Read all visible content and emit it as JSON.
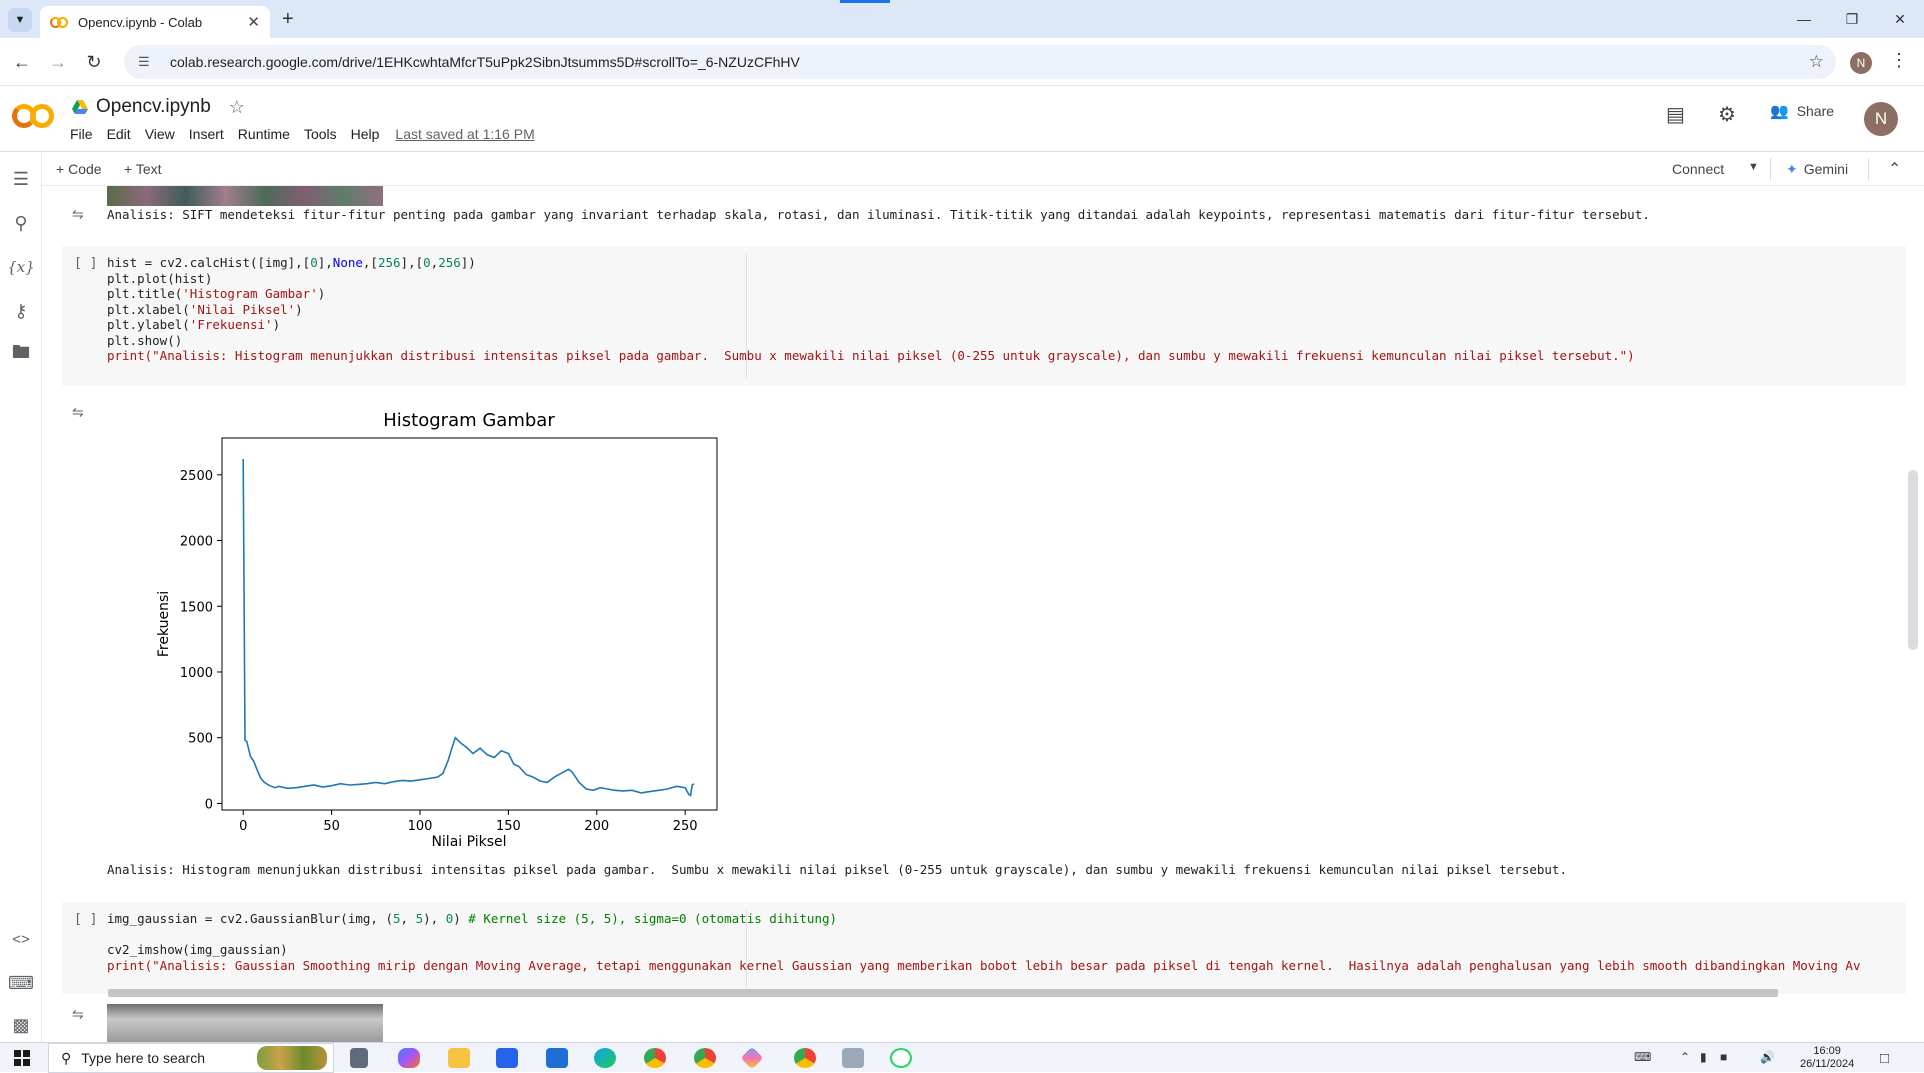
{
  "browser": {
    "tab_title": "Opencv.ipynb - Colab",
    "url": "colab.research.google.com/drive/1EHKcwhtaMfcrT5uPpk2SibnJtsumms5D#scrollTo=_6-NZUzCFhHV",
    "profile_initial": "N"
  },
  "colab": {
    "notebook_name": "Opencv.ipynb",
    "menu": [
      "File",
      "Edit",
      "View",
      "Insert",
      "Runtime",
      "Tools",
      "Help"
    ],
    "last_saved": "Last saved at 1:16 PM",
    "share_label": "Share",
    "user_initial": "N"
  },
  "toolbar": {
    "add_code": "Code",
    "add_text": "Text",
    "connect": "Connect",
    "gemini": "Gemini"
  },
  "cells": {
    "sift_output": "Analisis: SIFT mendeteksi fitur-fitur penting pada gambar yang invariant terhadap skala, rotasi, dan iluminasi. Titik-titik yang ditandai adalah keypoints, representasi matematis dari fitur-fitur tersebut.",
    "hist_run": "[ ]",
    "hist_output": "Analisis: Histogram menunjukkan distribusi intensitas piksel pada gambar.  Sumbu x mewakili nilai piksel (0-255 untuk grayscale), dan sumbu y mewakili frekuensi kemunculan nilai piksel tersebut.",
    "gauss_run": "[ ]"
  },
  "chart_data": {
    "type": "line",
    "title": "Histogram Gambar",
    "xlabel": "Nilai Piksel",
    "ylabel": "Frekuensi",
    "xlim": [
      -12,
      268
    ],
    "ylim": [
      -50,
      2780
    ],
    "xticks": [
      0,
      50,
      100,
      150,
      200,
      250
    ],
    "yticks": [
      0,
      500,
      1000,
      1500,
      2000,
      2500
    ],
    "color": "#1f77b4",
    "x": [
      0,
      1,
      2,
      4,
      6,
      8,
      10,
      12,
      15,
      18,
      20,
      25,
      30,
      35,
      40,
      45,
      50,
      55,
      60,
      65,
      70,
      75,
      80,
      85,
      90,
      95,
      100,
      105,
      110,
      113,
      116,
      118,
      120,
      123,
      126,
      130,
      134,
      138,
      142,
      146,
      150,
      153,
      156,
      160,
      164,
      168,
      172,
      176,
      180,
      184,
      186,
      188,
      190,
      194,
      198,
      202,
      206,
      210,
      215,
      220,
      225,
      230,
      235,
      240,
      245,
      250,
      252,
      253,
      254,
      255
    ],
    "values": [
      2620,
      480,
      470,
      360,
      320,
      250,
      190,
      160,
      135,
      120,
      130,
      115,
      120,
      130,
      140,
      125,
      135,
      150,
      140,
      145,
      150,
      160,
      150,
      165,
      175,
      170,
      180,
      190,
      200,
      230,
      330,
      420,
      500,
      460,
      430,
      380,
      420,
      370,
      350,
      400,
      380,
      300,
      280,
      220,
      200,
      170,
      160,
      200,
      230,
      260,
      240,
      200,
      160,
      110,
      100,
      120,
      110,
      100,
      95,
      100,
      80,
      90,
      100,
      110,
      130,
      120,
      70,
      60,
      140,
      150
    ]
  }
}
